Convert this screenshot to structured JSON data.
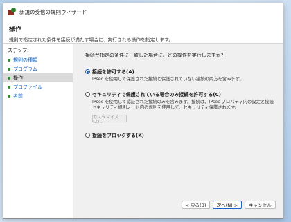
{
  "window": {
    "title": "新規の受信の規則ウィザード"
  },
  "header": {
    "title": "操作",
    "description": "規則で指定された条件を接続が満たす場合に、実行される操作を指定します。"
  },
  "steps": {
    "label": "ステップ:",
    "items": [
      {
        "label": "規則の種類",
        "current": false
      },
      {
        "label": "プログラム",
        "current": false
      },
      {
        "label": "操作",
        "current": true
      },
      {
        "label": "プロファイル",
        "current": false
      },
      {
        "label": "名前",
        "current": false
      }
    ]
  },
  "content": {
    "question": "接続が指定の条件に一致した場合に、どの操作を実行しますか?",
    "options": [
      {
        "label": "接続を許可する(A)",
        "description": [
          "IPsec を使用して保護された接続と保護されていない接続の両方を含みます。"
        ],
        "selected": true
      },
      {
        "label": "セキュリティで保護されている場合のみ接続を許可する(C)",
        "description": [
          "IPsec を使用して認証された接続のみを含みます。接続は、IPsec プロパティ内の設定と接続",
          "セキュリティ規則ノード内の規則を使用して、セキュリティ保護されます。"
        ],
        "selected": false
      },
      {
        "label": "接続をブロックする(K)",
        "description": [],
        "selected": false
      }
    ],
    "customize_label": "カスタマイズ(Z)..."
  },
  "footer": {
    "back_label": "< 戻る(B)",
    "next_label": "次へ(N) >",
    "cancel_label": "キャンセル"
  },
  "colors": {
    "accent": "#1a64c8",
    "step_link": "#1060c0",
    "step_dot": "#2e8b2e"
  }
}
